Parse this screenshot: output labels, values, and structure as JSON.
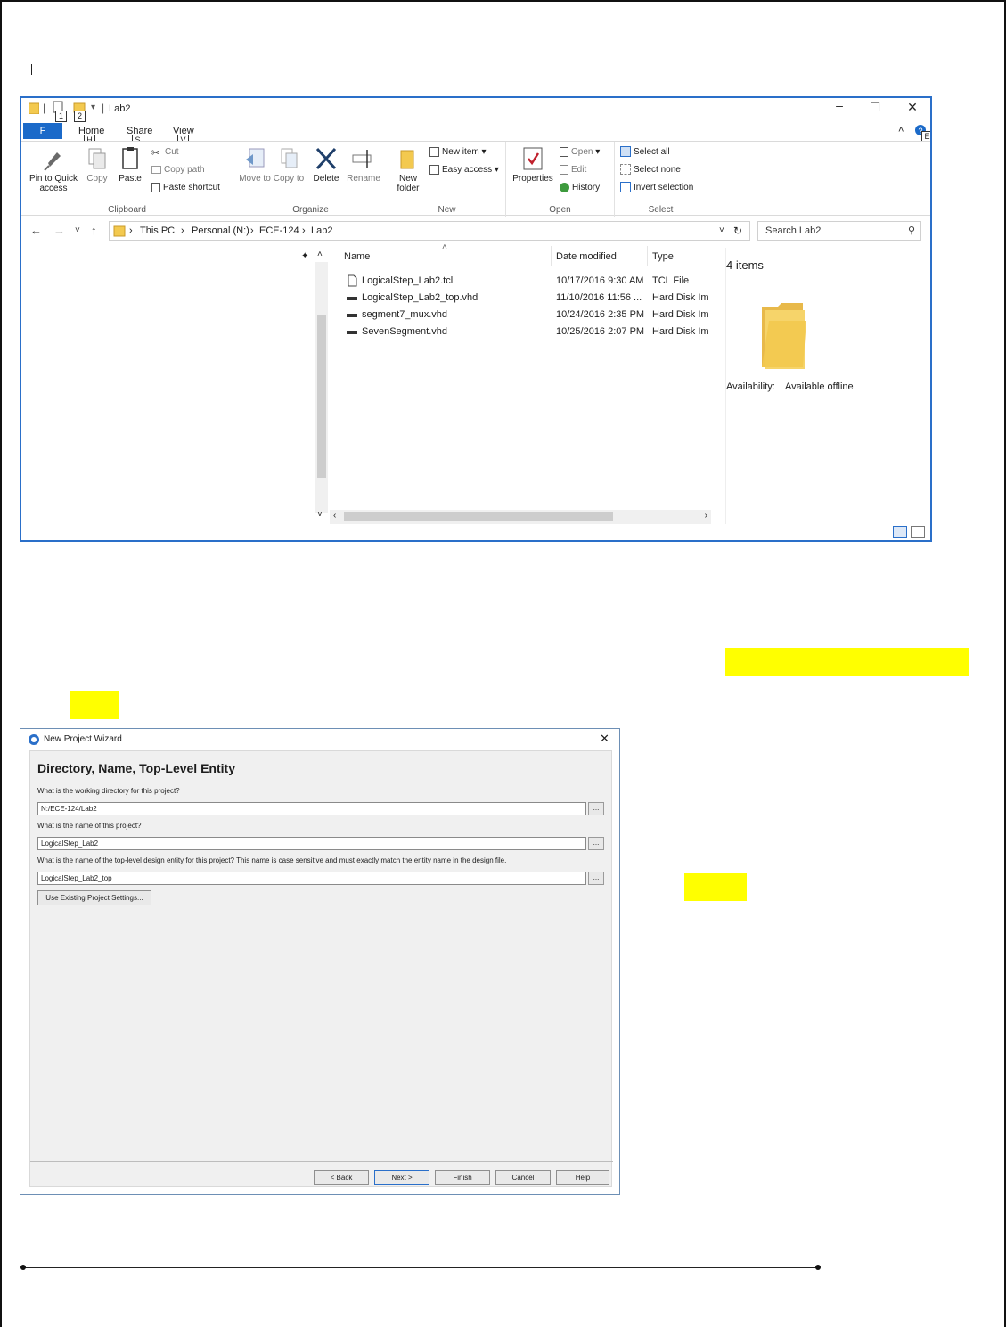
{
  "explorer": {
    "title": "Lab2",
    "qa_keytips": [
      "1",
      "2"
    ],
    "tabs": {
      "file": "F",
      "home": "Home",
      "home_key": "H",
      "share": "Share",
      "share_key": "S",
      "view": "View",
      "view_key": "V",
      "help_key": "E"
    },
    "ribbon": {
      "clipboard": {
        "label": "Clipboard",
        "pin": "Pin to Quick access",
        "copy": "Copy",
        "paste": "Paste",
        "cut": "Cut",
        "copy_path": "Copy path",
        "paste_shortcut": "Paste shortcut"
      },
      "organize": {
        "label": "Organize",
        "move_to": "Move to",
        "copy_to": "Copy to",
        "delete": "Delete",
        "rename": "Rename"
      },
      "new": {
        "label": "New",
        "new_folder": "New folder",
        "new_item": "New item",
        "easy_access": "Easy access"
      },
      "open": {
        "label": "Open",
        "properties": "Properties",
        "open": "Open",
        "edit": "Edit",
        "history": "History"
      },
      "select": {
        "label": "Select",
        "select_all": "Select all",
        "select_none": "Select none",
        "invert": "Invert selection"
      }
    },
    "address": {
      "crumbs": [
        "This PC",
        "Personal (N:)",
        "ECE-124",
        "Lab2"
      ],
      "search_placeholder": "Search Lab2"
    },
    "columns": {
      "name": "Name",
      "date": "Date modified",
      "type": "Type"
    },
    "files": [
      {
        "name": "LogicalStep_Lab2.tcl",
        "date": "10/17/2016 9:30 AM",
        "type": "TCL File",
        "icon": "document-icon"
      },
      {
        "name": "LogicalStep_Lab2_top.vhd",
        "date": "11/10/2016 11:56 ...",
        "type": "Hard Disk Im",
        "icon": "disk-image-icon"
      },
      {
        "name": "segment7_mux.vhd",
        "date": "10/24/2016 2:35 PM",
        "type": "Hard Disk Im",
        "icon": "disk-image-icon"
      },
      {
        "name": "SevenSegment.vhd",
        "date": "10/25/2016 2:07 PM",
        "type": "Hard Disk Im",
        "icon": "disk-image-icon"
      }
    ],
    "details": {
      "count": "4 items",
      "availability_label": "Availability:",
      "availability_value": "Available offline"
    }
  },
  "wizard": {
    "title": "New Project Wizard",
    "heading": "Directory, Name, Top-Level Entity",
    "q_dir": "What is the working directory for this project?",
    "dir_value": "N:/ECE-124/Lab2",
    "q_name": "What is the name of this project?",
    "name_value": "LogicalStep_Lab2",
    "q_top": "What is the name of the top-level design entity for this project? This name is case sensitive and must exactly match the entity name in the design file.",
    "top_value": "LogicalStep_Lab2_top",
    "browse": "...",
    "use_existing": "Use Existing Project Settings...",
    "buttons": {
      "back": "< Back",
      "next": "Next >",
      "finish": "Finish",
      "cancel": "Cancel",
      "help": "Help"
    }
  },
  "colors": {
    "accent": "#1b6ac9",
    "highlight": "#ffff00",
    "folder": "#f3c94f"
  }
}
